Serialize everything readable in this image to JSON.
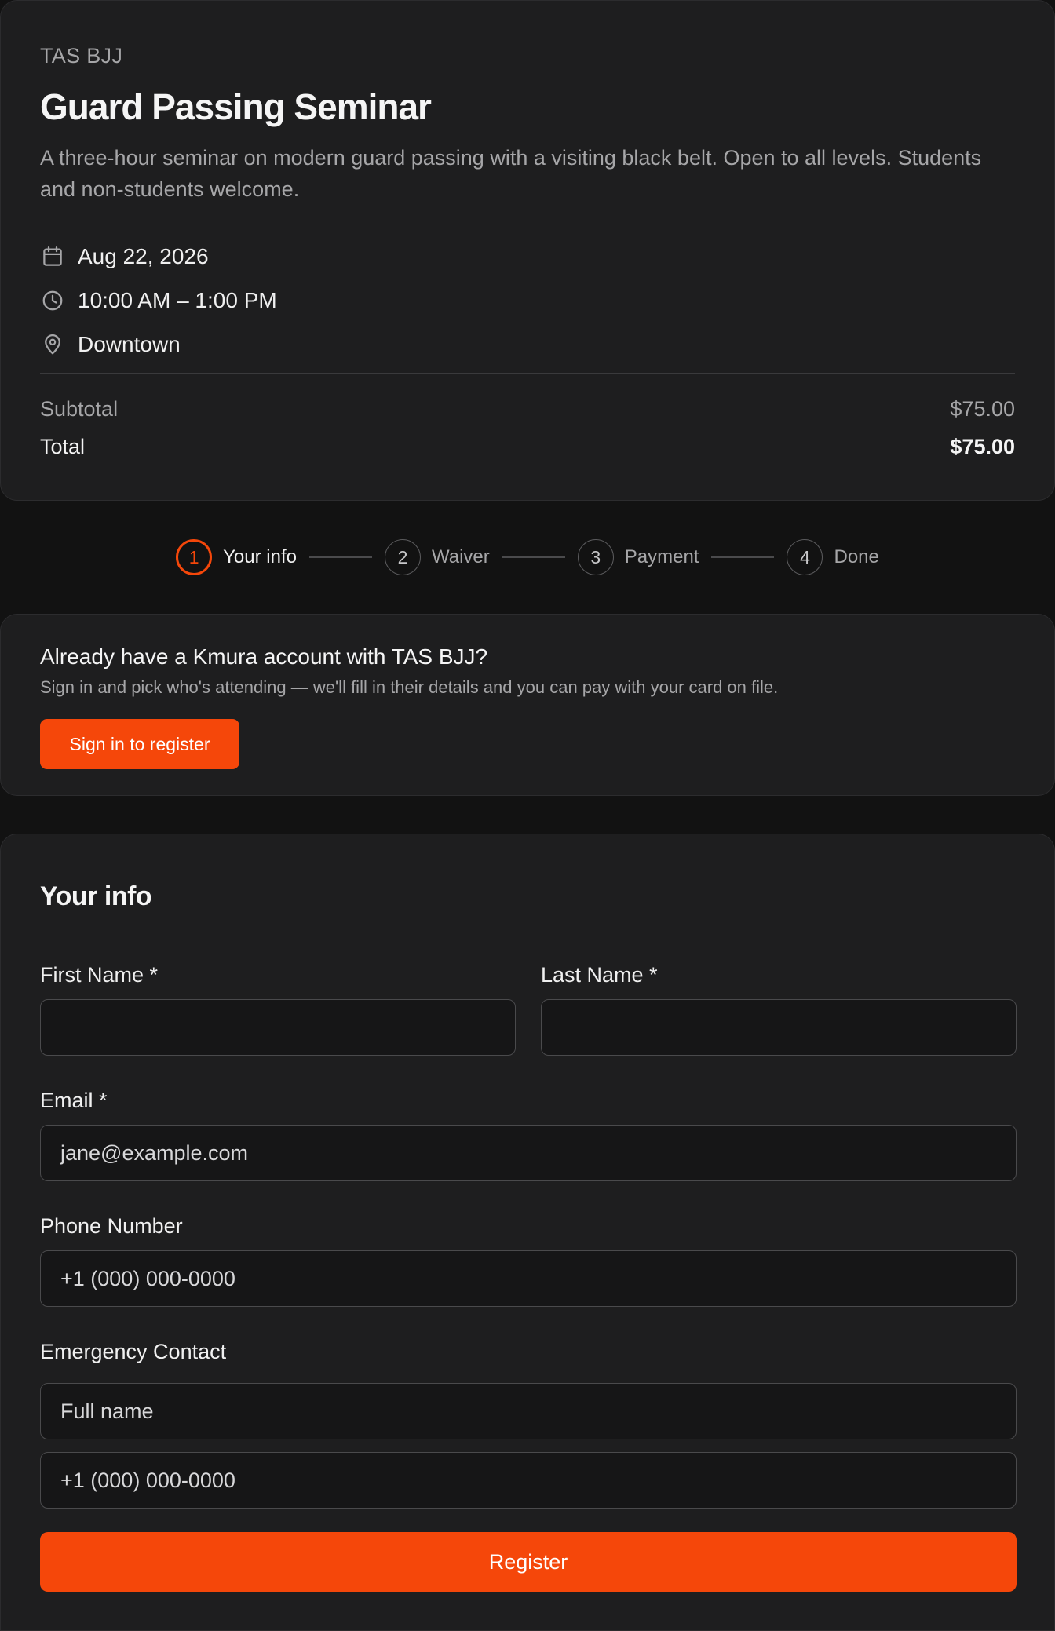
{
  "event": {
    "org": "TAS BJJ",
    "title": "Guard Passing Seminar",
    "description": "A three-hour seminar on modern guard passing with a visiting black belt. Open to all levels. Students and non-students welcome.",
    "date": "Aug 22, 2026",
    "time": "10:00 AM – 1:00 PM",
    "location": "Downtown",
    "subtotal_label": "Subtotal",
    "subtotal_value": "$75.00",
    "total_label": "Total",
    "total_value": "$75.00"
  },
  "steps": [
    {
      "num": "1",
      "label": "Your info",
      "active": true
    },
    {
      "num": "2",
      "label": "Waiver",
      "active": false
    },
    {
      "num": "3",
      "label": "Payment",
      "active": false
    },
    {
      "num": "4",
      "label": "Done",
      "active": false
    }
  ],
  "signin": {
    "title": "Already have a Kmura account with TAS BJJ?",
    "subtitle": "Sign in and pick who's attending — we'll fill in their details and you can pay with your card on file.",
    "button": "Sign in to register"
  },
  "form": {
    "title": "Your info",
    "first_name_label": "First Name *",
    "first_name_value": "",
    "last_name_label": "Last Name *",
    "last_name_value": "",
    "email_label": "Email *",
    "email_placeholder": "jane@example.com",
    "phone_label": "Phone Number",
    "phone_placeholder": "+1 (000) 000-0000",
    "emergency_label": "Emergency Contact",
    "emergency_name_placeholder": "Full name",
    "emergency_phone_placeholder": "+1 (000) 000-0000",
    "register_button": "Register"
  },
  "colors": {
    "accent": "#f5470a",
    "background": "#121212",
    "card": "#1e1e1f"
  },
  "icons": {
    "date": "calendar-icon",
    "time": "clock-icon",
    "location": "map-pin-icon"
  }
}
